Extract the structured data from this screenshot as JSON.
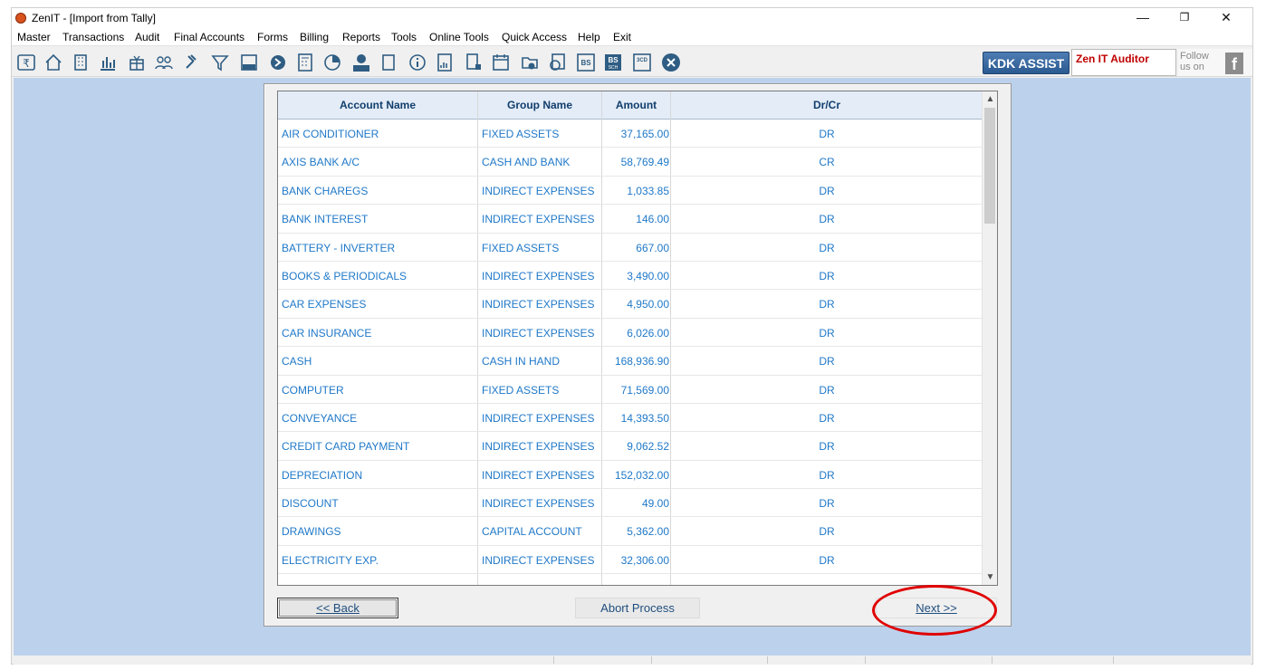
{
  "window": {
    "title": "ZenIT - [Import from Tally]",
    "minimize_icon": "minimize-icon",
    "restore_icon": "restore-icon",
    "close_icon": "close-icon"
  },
  "menu": [
    "Master",
    "Transactions",
    "Audit",
    "Final Accounts",
    "Forms",
    "Billing",
    "Reports",
    "Tools",
    "Online Tools",
    "Quick Access",
    "Help",
    "Exit"
  ],
  "toolbar": {
    "icons": [
      "rupee-icon",
      "home-icon",
      "building-icon",
      "bar-chart-icon",
      "gift-icon",
      "users-icon",
      "gavel-icon",
      "filter-icon",
      "tax-calculator-icon",
      "arrows-icon",
      "calculator-icon",
      "pie-icon",
      "pay-icon",
      "book-icon",
      "info-icon",
      "report-icon",
      "document-icon",
      "calendar-icon",
      "folder-add-icon",
      "refresh-doc-icon",
      "bs-icon",
      "bs-sch-icon",
      "3cd-icon",
      "close-circle-icon"
    ],
    "kdk_assist_label": "KDK ASSIST",
    "zen_it_auditor_label": "Zen IT Auditor",
    "follow_label": "Follow us on"
  },
  "table": {
    "columns": [
      "Account Name",
      "Group Name",
      "Amount",
      "Dr/Cr"
    ],
    "rows": [
      [
        "AIR CONDITIONER",
        "FIXED ASSETS",
        "37,165.00",
        "DR"
      ],
      [
        "AXIS BANK A/C",
        "CASH AND BANK",
        "58,769.49",
        "CR"
      ],
      [
        "BANK CHAREGS",
        "INDIRECT EXPENSES",
        "1,033.85",
        "DR"
      ],
      [
        "BANK INTEREST",
        "INDIRECT EXPENSES",
        "146.00",
        "DR"
      ],
      [
        "BATTERY - INVERTER",
        "FIXED ASSETS",
        "667.00",
        "DR"
      ],
      [
        "BOOKS & PERIODICALS",
        "INDIRECT EXPENSES",
        "3,490.00",
        "DR"
      ],
      [
        "CAR EXPENSES",
        "INDIRECT EXPENSES",
        "4,950.00",
        "DR"
      ],
      [
        "CAR INSURANCE",
        "INDIRECT EXPENSES",
        "6,026.00",
        "DR"
      ],
      [
        "CASH",
        "CASH IN HAND",
        "168,936.90",
        "DR"
      ],
      [
        "COMPUTER",
        "FIXED ASSETS",
        "71,569.00",
        "DR"
      ],
      [
        "CONVEYANCE",
        "INDIRECT EXPENSES",
        "14,393.50",
        "DR"
      ],
      [
        "CREDIT CARD PAYMENT",
        "INDIRECT EXPENSES",
        "9,062.52",
        "DR"
      ],
      [
        "DEPRECIATION",
        "INDIRECT EXPENSES",
        "152,032.00",
        "DR"
      ],
      [
        "DISCOUNT",
        "INDIRECT EXPENSES",
        "49.00",
        "DR"
      ],
      [
        "DRAWINGS",
        "CAPITAL ACCOUNT",
        "5,362.00",
        "DR"
      ],
      [
        "ELECTRICITY EXP.",
        "INDIRECT EXPENSES",
        "32,306.00",
        "DR"
      ]
    ]
  },
  "buttons": {
    "back_label": "<<  Back",
    "abort_label": "Abort Process",
    "next_label": "Next >>"
  },
  "colors": {
    "accent": "#1f78c8",
    "background": "#bcd1eb",
    "highlight_circle": "#e00000"
  }
}
